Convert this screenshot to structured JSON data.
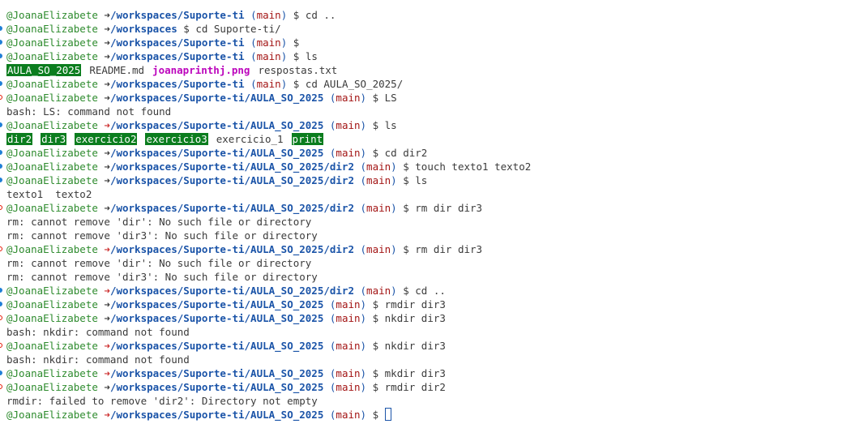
{
  "terminal": {
    "lines": [
      {
        "type": "prompt",
        "status": "none",
        "user": "@JoanaElizabete",
        "path": "/workspaces/Suporte-ti",
        "branch": "main",
        "command": "cd .."
      },
      {
        "type": "prompt",
        "status": "success",
        "user": "@JoanaElizabete",
        "path": "/workspaces",
        "branch": null,
        "command": "cd Suporte-ti/"
      },
      {
        "type": "prompt",
        "status": "success",
        "user": "@JoanaElizabete",
        "path": "/workspaces/Suporte-ti",
        "branch": "main",
        "command": ""
      },
      {
        "type": "prompt",
        "status": "success",
        "user": "@JoanaElizabete",
        "path": "/workspaces/Suporte-ti",
        "branch": "main",
        "command": "ls"
      },
      {
        "type": "ls",
        "items": [
          {
            "name": "AULA_SO_2025",
            "kind": "dir-hl"
          },
          {
            "name": "README.md",
            "kind": "file"
          },
          {
            "name": "joanaprinthj.png",
            "kind": "img"
          },
          {
            "name": "respostas.txt",
            "kind": "file"
          }
        ]
      },
      {
        "type": "prompt",
        "status": "success",
        "user": "@JoanaElizabete",
        "path": "/workspaces/Suporte-ti",
        "branch": "main",
        "command": "cd AULA_SO_2025/"
      },
      {
        "type": "prompt",
        "status": "error",
        "user": "@JoanaElizabete",
        "path": "/workspaces/Suporte-ti/AULA_SO_2025",
        "branch": "main",
        "command": "LS"
      },
      {
        "type": "output",
        "text": "bash: LS: command not found"
      },
      {
        "type": "prompt",
        "status": "success",
        "arrow": "err",
        "user": "@JoanaElizabete",
        "path": "/workspaces/Suporte-ti/AULA_SO_2025",
        "branch": "main",
        "command": "ls"
      },
      {
        "type": "ls",
        "items": [
          {
            "name": "dir2",
            "kind": "dir-hl"
          },
          {
            "name": "dir3",
            "kind": "dir-hl"
          },
          {
            "name": "exercicio2",
            "kind": "dir-hl"
          },
          {
            "name": "exercicio3",
            "kind": "dir-hl"
          },
          {
            "name": "exercicio_1",
            "kind": "file"
          },
          {
            "name": "print",
            "kind": "dir-hl"
          }
        ]
      },
      {
        "type": "prompt",
        "status": "success",
        "user": "@JoanaElizabete",
        "path": "/workspaces/Suporte-ti/AULA_SO_2025",
        "branch": "main",
        "command": "cd dir2"
      },
      {
        "type": "prompt",
        "status": "success",
        "user": "@JoanaElizabete",
        "path": "/workspaces/Suporte-ti/AULA_SO_2025/dir2",
        "branch": "main",
        "command": "touch texto1 texto2"
      },
      {
        "type": "prompt",
        "status": "success",
        "user": "@JoanaElizabete",
        "path": "/workspaces/Suporte-ti/AULA_SO_2025/dir2",
        "branch": "main",
        "command": "ls"
      },
      {
        "type": "output",
        "text": "texto1  texto2"
      },
      {
        "type": "prompt",
        "status": "error",
        "user": "@JoanaElizabete",
        "path": "/workspaces/Suporte-ti/AULA_SO_2025/dir2",
        "branch": "main",
        "command": "rm dir dir3"
      },
      {
        "type": "output",
        "text": "rm: cannot remove 'dir': No such file or directory"
      },
      {
        "type": "output",
        "text": "rm: cannot remove 'dir3': No such file or directory"
      },
      {
        "type": "prompt",
        "status": "error",
        "arrow": "err",
        "user": "@JoanaElizabete",
        "path": "/workspaces/Suporte-ti/AULA_SO_2025/dir2",
        "branch": "main",
        "command": "rm dir dir3"
      },
      {
        "type": "output",
        "text": "rm: cannot remove 'dir': No such file or directory"
      },
      {
        "type": "output",
        "text": "rm: cannot remove 'dir3': No such file or directory"
      },
      {
        "type": "prompt",
        "status": "success",
        "arrow": "err",
        "user": "@JoanaElizabete",
        "path": "/workspaces/Suporte-ti/AULA_SO_2025/dir2",
        "branch": "main",
        "command": "cd .."
      },
      {
        "type": "prompt",
        "status": "success",
        "user": "@JoanaElizabete",
        "path": "/workspaces/Suporte-ti/AULA_SO_2025",
        "branch": "main",
        "command": "rmdir dir3"
      },
      {
        "type": "prompt",
        "status": "error",
        "user": "@JoanaElizabete",
        "path": "/workspaces/Suporte-ti/AULA_SO_2025",
        "branch": "main",
        "command": "nkdir dir3"
      },
      {
        "type": "output",
        "text": "bash: nkdir: command not found"
      },
      {
        "type": "prompt",
        "status": "error",
        "arrow": "err",
        "user": "@JoanaElizabete",
        "path": "/workspaces/Suporte-ti/AULA_SO_2025",
        "branch": "main",
        "command": "nkdir dir3"
      },
      {
        "type": "output",
        "text": "bash: nkdir: command not found"
      },
      {
        "type": "prompt",
        "status": "success",
        "arrow": "err",
        "user": "@JoanaElizabete",
        "path": "/workspaces/Suporte-ti/AULA_SO_2025",
        "branch": "main",
        "command": "mkdir dir3"
      },
      {
        "type": "prompt",
        "status": "error",
        "user": "@JoanaElizabete",
        "path": "/workspaces/Suporte-ti/AULA_SO_2025",
        "branch": "main",
        "command": "rmdir dir2"
      },
      {
        "type": "output",
        "text": "rmdir: failed to remove 'dir2': Directory not empty"
      },
      {
        "type": "prompt",
        "status": "none",
        "arrow": "err",
        "user": "@JoanaElizabete",
        "path": "/workspaces/Suporte-ti/AULA_SO_2025",
        "branch": "main",
        "command": "",
        "cursor": true
      }
    ]
  },
  "colors": {
    "background": "#ffffff",
    "user": "#2e8b2e",
    "path": "#1b54a8",
    "branch": "#a31515",
    "error_arrow": "#cd3131",
    "dir_highlight": "#0b7d1e",
    "image_file": "#bc05bc"
  },
  "icons": {
    "arrow": "➜",
    "success_marker": "circle-filled-icon",
    "error_marker": "circle-outline-icon"
  }
}
